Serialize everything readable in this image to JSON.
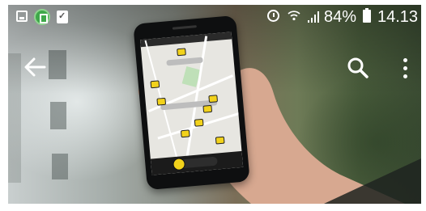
{
  "status_bar": {
    "battery_percent": "84%",
    "time": "14.13",
    "icons": [
      "gallery-icon",
      "notification-app-icon",
      "clipboard-check-icon",
      "alarm-icon",
      "wifi-icon",
      "signal-icon",
      "battery-icon"
    ]
  },
  "action_bar": {
    "icons": [
      "back-arrow-icon",
      "search-icon",
      "more-vert-icon"
    ],
    "icon_color": "#ffffff"
  },
  "phone_preview": {
    "taxi_color": "#f2d21b",
    "map_bg_color": "#e7e6e1"
  }
}
